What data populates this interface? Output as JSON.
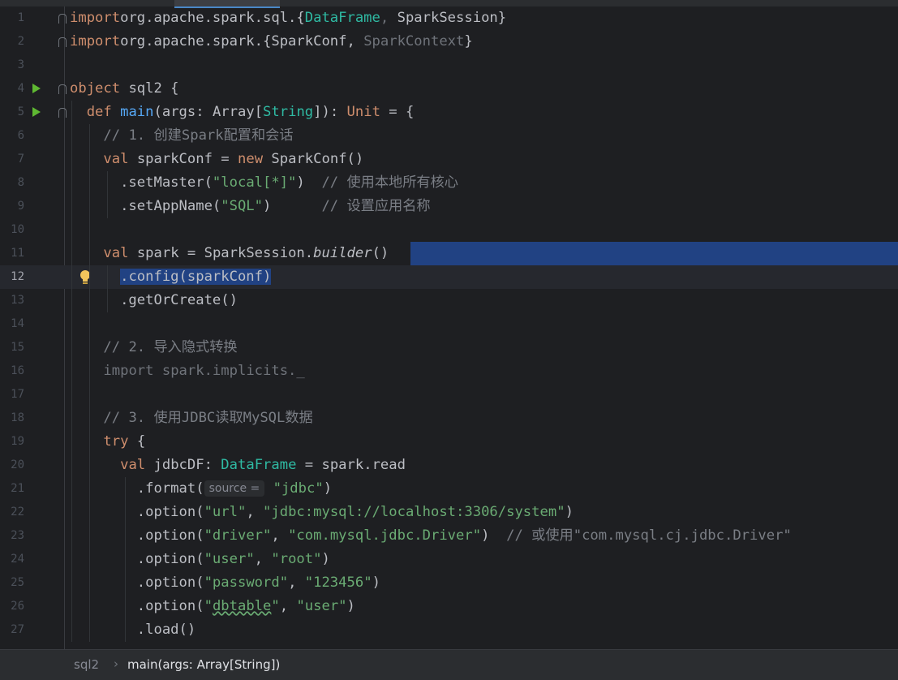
{
  "editor": {
    "breadcrumb": [
      "sql2",
      "main(args: Array[String])"
    ],
    "current_line": 12,
    "lines": [
      {
        "n": "1",
        "t": [
          [
            "kw",
            "import"
          ],
          [
            "",
            "org.apache.spark.sql.{"
          ],
          [
            "ty",
            "DataFrame"
          ],
          [
            "gray",
            ", "
          ],
          [
            "",
            "SparkSession}"
          ]
        ]
      },
      {
        "n": "2",
        "t": [
          [
            "kw",
            "import"
          ],
          [
            "",
            "org.apache.spark.{SparkConf, "
          ],
          [
            "gray",
            "SparkContext"
          ],
          [
            "",
            "}"
          ]
        ]
      },
      {
        "n": "3",
        "t": []
      },
      {
        "n": "4",
        "t": [
          [
            "kw",
            "object "
          ],
          [
            "",
            "sql2 {"
          ]
        ]
      },
      {
        "n": "5",
        "t": [
          [
            "",
            "  "
          ],
          [
            "kw",
            "def "
          ],
          [
            "fn",
            "main"
          ],
          [
            "",
            "(args: Array["
          ],
          [
            "ty",
            "String"
          ],
          [
            "",
            "]): "
          ],
          [
            "kw",
            "Unit"
          ],
          [
            "",
            " = {"
          ]
        ]
      },
      {
        "n": "6",
        "t": [
          [
            "",
            "    "
          ],
          [
            "cm",
            "// 1. 创建Spark配置和会话"
          ]
        ]
      },
      {
        "n": "7",
        "t": [
          [
            "",
            "    "
          ],
          [
            "kw",
            "val "
          ],
          [
            "",
            "sparkConf = "
          ],
          [
            "kw",
            "new "
          ],
          [
            "",
            "SparkConf()"
          ]
        ]
      },
      {
        "n": "8",
        "t": [
          [
            "",
            "      .setMaster("
          ],
          [
            "str",
            "\"local[*]\""
          ],
          [
            "",
            ")  "
          ],
          [
            "cm",
            "// 使用本地所有核心"
          ]
        ]
      },
      {
        "n": "9",
        "t": [
          [
            "",
            "      .setAppName("
          ],
          [
            "str",
            "\"SQL\""
          ],
          [
            "",
            ")      "
          ],
          [
            "cm",
            "// 设置应用名称"
          ]
        ]
      },
      {
        "n": "10",
        "t": []
      },
      {
        "n": "11",
        "t": [
          [
            "",
            "    "
          ],
          [
            "kw",
            "val "
          ],
          [
            "",
            "spark = SparkSession."
          ],
          [
            "it",
            "builder"
          ],
          [
            "",
            "()"
          ]
        ]
      },
      {
        "n": "12",
        "t": [
          [
            "",
            "      "
          ],
          [
            "sel",
            ".config(sparkConf)"
          ]
        ]
      },
      {
        "n": "13",
        "t": [
          [
            "",
            "      .getOrCreate()"
          ]
        ]
      },
      {
        "n": "14",
        "t": []
      },
      {
        "n": "15",
        "t": [
          [
            "",
            "    "
          ],
          [
            "cm",
            "// 2. 导入隐式转换"
          ]
        ]
      },
      {
        "n": "16",
        "t": [
          [
            "",
            "    "
          ],
          [
            "gray",
            "import spark.implicits._"
          ]
        ]
      },
      {
        "n": "17",
        "t": []
      },
      {
        "n": "18",
        "t": [
          [
            "",
            "    "
          ],
          [
            "cm",
            "// 3. 使用JDBC读取MySQL数据"
          ]
        ]
      },
      {
        "n": "19",
        "t": [
          [
            "",
            "    "
          ],
          [
            "kw",
            "try "
          ],
          [
            "",
            "{"
          ]
        ]
      },
      {
        "n": "20",
        "t": [
          [
            "",
            "      "
          ],
          [
            "kw",
            "val "
          ],
          [
            "",
            "jdbcDF: "
          ],
          [
            "ty",
            "DataFrame"
          ],
          [
            "",
            " = spark.read"
          ]
        ]
      },
      {
        "n": "21",
        "t": [
          [
            "",
            "        .format("
          ],
          [
            "hint",
            "source ="
          ],
          [
            "",
            " "
          ],
          [
            "str",
            "\"jdbc\""
          ],
          [
            "",
            ")"
          ]
        ]
      },
      {
        "n": "22",
        "t": [
          [
            "",
            "        .option("
          ],
          [
            "str",
            "\"url\""
          ],
          [
            "",
            ", "
          ],
          [
            "str",
            "\"jdbc:mysql://localhost:3306/system\""
          ],
          [
            "",
            ")"
          ]
        ]
      },
      {
        "n": "23",
        "t": [
          [
            "",
            "        .option("
          ],
          [
            "str",
            "\"driver\""
          ],
          [
            "",
            ", "
          ],
          [
            "str",
            "\"com.mysql.jdbc.Driver\""
          ],
          [
            "",
            ")  "
          ],
          [
            "cm",
            "// 或使用\"com.mysql.cj.jdbc.Driver\""
          ]
        ]
      },
      {
        "n": "24",
        "t": [
          [
            "",
            "        .option("
          ],
          [
            "str",
            "\"user\""
          ],
          [
            "",
            ", "
          ],
          [
            "str",
            "\"root\""
          ],
          [
            "",
            ")"
          ]
        ]
      },
      {
        "n": "25",
        "t": [
          [
            "",
            "        .option("
          ],
          [
            "str",
            "\"password\""
          ],
          [
            "",
            ", "
          ],
          [
            "str",
            "\"123456\""
          ],
          [
            "",
            ")"
          ]
        ]
      },
      {
        "n": "26",
        "t": [
          [
            "",
            "        .option("
          ],
          [
            "str",
            "\""
          ],
          [
            "wavy",
            "dbtable"
          ],
          [
            "str",
            "\""
          ],
          [
            "",
            ", "
          ],
          [
            "str",
            "\"user\""
          ],
          [
            "",
            ")"
          ]
        ]
      },
      {
        "n": "27",
        "t": [
          [
            "",
            "        .load()"
          ]
        ]
      }
    ]
  }
}
